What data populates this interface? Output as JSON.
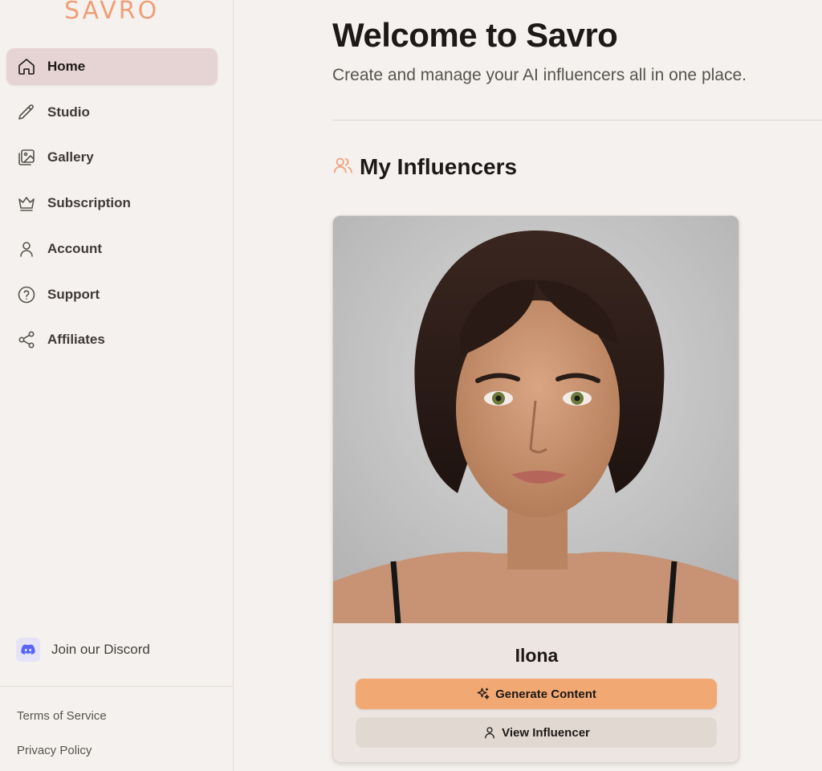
{
  "brand": {
    "logo_text": "SAVRO",
    "accent_color": "#ef9f78"
  },
  "sidebar": {
    "items": [
      {
        "label": "Home",
        "icon": "home-icon",
        "active": true
      },
      {
        "label": "Studio",
        "icon": "pencil-icon",
        "active": false
      },
      {
        "label": "Gallery",
        "icon": "gallery-icon",
        "active": false
      },
      {
        "label": "Subscription",
        "icon": "crown-icon",
        "active": false
      },
      {
        "label": "Account",
        "icon": "user-icon",
        "active": false
      },
      {
        "label": "Support",
        "icon": "help-circle-icon",
        "active": false
      },
      {
        "label": "Affiliates",
        "icon": "share-icon",
        "active": false
      }
    ],
    "discord": {
      "label": "Join our Discord",
      "icon": "discord-icon",
      "color": "#5865f2"
    },
    "footer": {
      "terms": "Terms of Service",
      "privacy": "Privacy Policy"
    }
  },
  "main": {
    "title": "Welcome to Savro",
    "subtitle": "Create and manage your AI influencers all in one place.",
    "section": {
      "title": "My Influencers",
      "icon": "users-icon"
    },
    "influencers": [
      {
        "name": "Ilona",
        "generate_label": "Generate Content",
        "view_label": "View Influencer",
        "photo": "portrait-photo"
      }
    ]
  },
  "colors": {
    "primary_button": "#f2a873",
    "active_nav": "#e6d4d4",
    "background": "#f5f1ee"
  }
}
